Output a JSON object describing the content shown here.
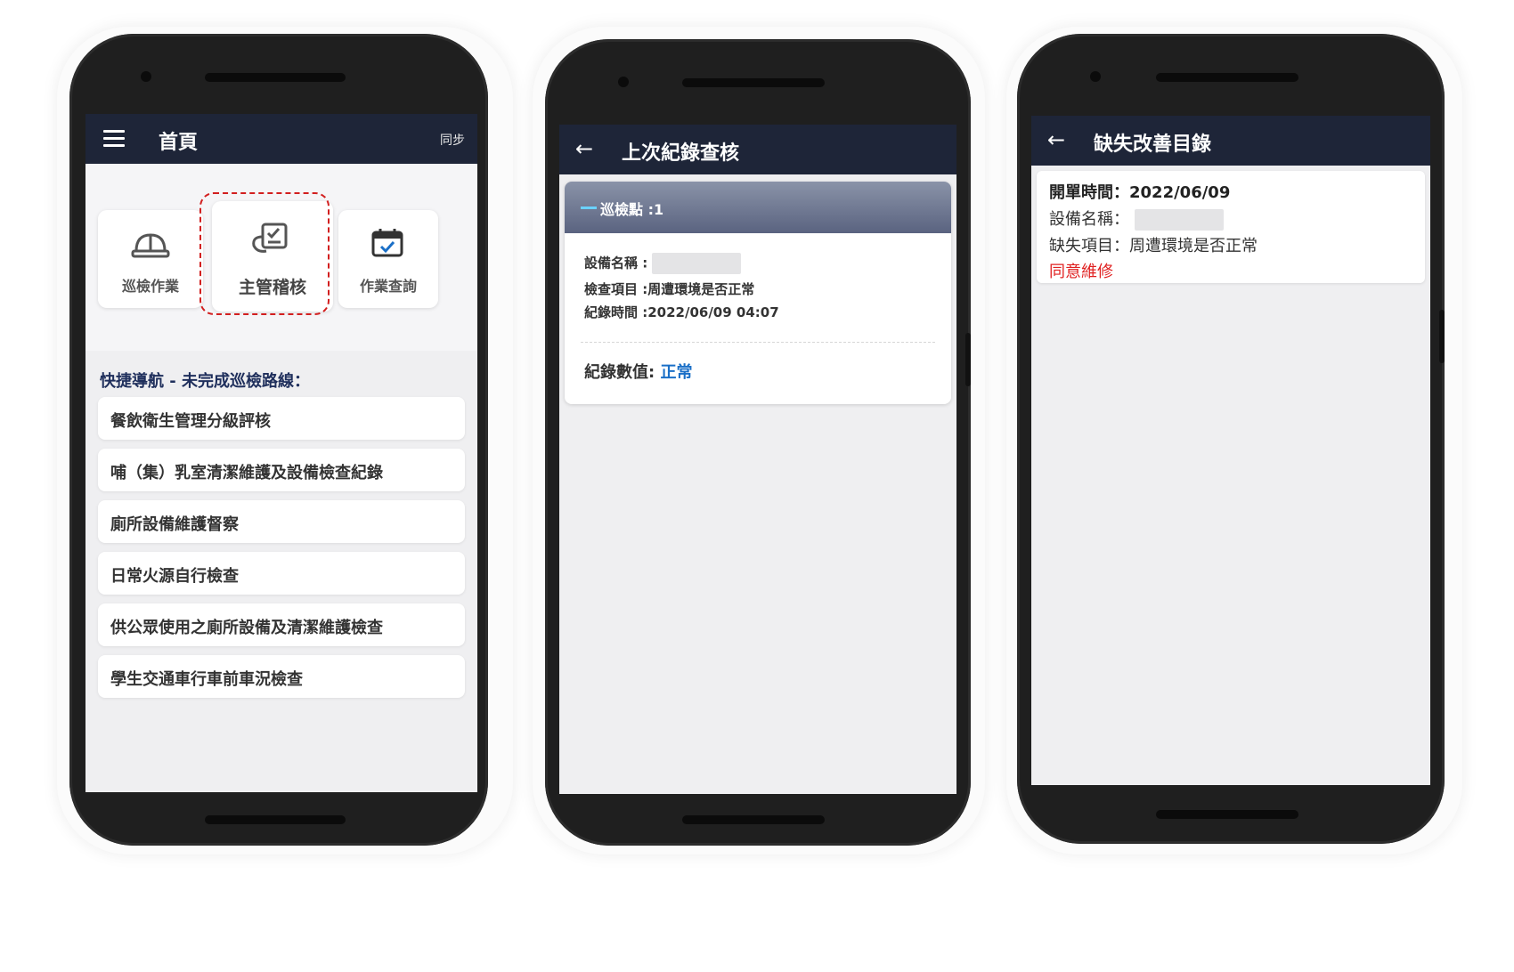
{
  "screen_home": {
    "title": "首頁",
    "sync_label": "同步",
    "tiles": [
      {
        "label": "巡檢作業",
        "icon": "hard-hat-icon"
      },
      {
        "label": "主管稽核",
        "icon": "audit-clipboard-icon"
      },
      {
        "label": "作業查詢",
        "icon": "calendar-check-icon"
      }
    ],
    "quick_nav_title": "快捷導航 - 未完成巡檢路線：",
    "routes": [
      "餐飲衛生管理分級評核",
      "哺（集）乳室清潔維護及設備檢查紀錄",
      "廁所設備維護督察",
      "日常火源自行檢查",
      "供公眾使用之廁所設備及清潔維護檢查",
      "學生交通車行車前車況檢查"
    ]
  },
  "screen_record": {
    "title": "上次紀錄查核",
    "card_title": "巡檢點 :1",
    "device_label": "設備名稱 :",
    "check_item": "檢查項目 :周遭環境是否正常",
    "record_time": "紀錄時間 :2022/06/09 04:07",
    "value_label": "紀錄數值:",
    "value": "正常"
  },
  "screen_defect": {
    "title": "缺失改善目錄",
    "open_time": "開單時間：2022/06/09",
    "device_label": "設備名稱：",
    "defect_item": "缺失項目：周遭環境是否正常",
    "status": "同意維修"
  },
  "colors": {
    "appbar": "#1e2538",
    "highlight_dash": "#d21f1f",
    "value_blue": "#1a6fc7",
    "status_red": "#e02020"
  }
}
